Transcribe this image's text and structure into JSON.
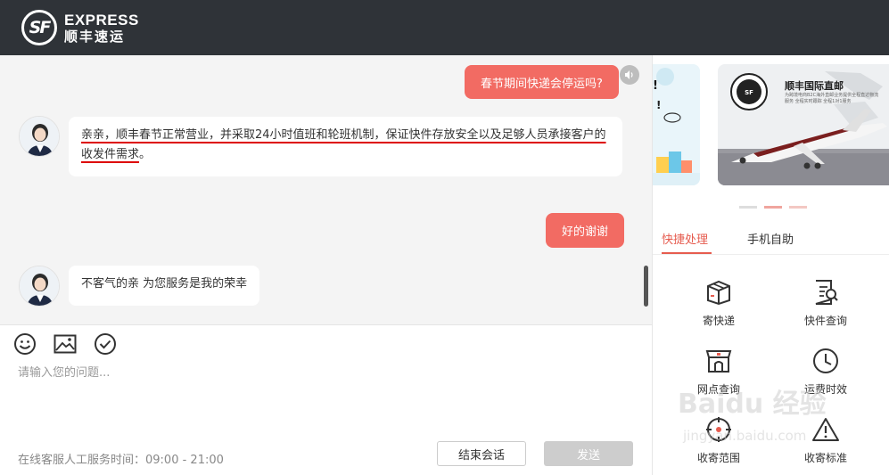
{
  "header": {
    "logo_mark": "SF",
    "logo_en": "EXPRESS",
    "logo_cn": "顺丰速运"
  },
  "chat": {
    "messages": [
      {
        "side": "right",
        "text": "春节期间快递会停运吗?"
      },
      {
        "side": "left",
        "text_line1": "亲亲，顺丰春节正常营业，并采取24小时值班和轮班机制，保证快件存放安全以及足够人员承接客户的",
        "text_line2": "收发件需求",
        "text_line2_tail": "。"
      },
      {
        "side": "right",
        "text": "好的谢谢"
      },
      {
        "side": "left",
        "text": "不客气的亲 为您服务是我的荣幸"
      }
    ]
  },
  "input": {
    "placeholder": "请输入您的问题...",
    "service_hours": "在线客服人工服务时间：09:00 - 21:00",
    "end_button": "结束会话",
    "send_button": "发送"
  },
  "right_panel": {
    "banner_title": "顺丰国际直邮",
    "banner_sub": "为跨境电商B2C海外直邮业务提供全程直达物流服务 全程实时跟踪 全程1对1服务",
    "tabs": [
      "快捷处理",
      "手机自助"
    ],
    "quick_actions": [
      {
        "label": "寄快递",
        "icon": "box-icon"
      },
      {
        "label": "快件查询",
        "icon": "document-search-icon"
      },
      {
        "label": "网点查询",
        "icon": "store-icon"
      },
      {
        "label": "运费时效",
        "icon": "clock-icon"
      },
      {
        "label": "收寄范围",
        "icon": "target-icon"
      },
      {
        "label": "收寄标准",
        "icon": "warning-icon"
      }
    ]
  },
  "watermark": {
    "text1": "Baidu 经验",
    "text2": "jingyan.baidu.com"
  }
}
